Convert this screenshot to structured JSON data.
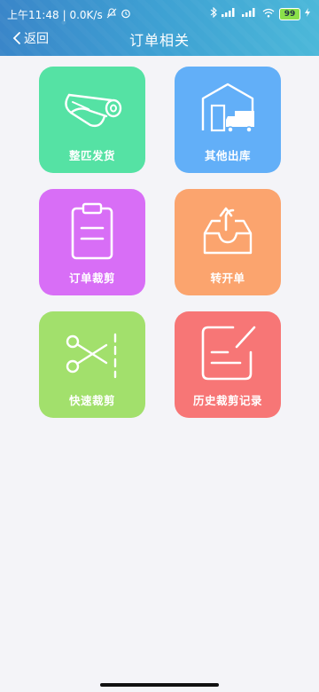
{
  "status_bar": {
    "time": "上午11:48",
    "network_speed": "| 0.0K/s",
    "battery_level": "99"
  },
  "header": {
    "back_label": "返回",
    "title": "订单相关"
  },
  "tiles": [
    {
      "label": "整匹发货",
      "color": "#55e2a4",
      "icon": "fabric-roll-icon"
    },
    {
      "label": "其他出库",
      "color": "#62aff8",
      "icon": "warehouse-truck-icon"
    },
    {
      "label": "订单裁剪",
      "color": "#d86ef6",
      "icon": "clipboard-icon"
    },
    {
      "label": "转开单",
      "color": "#fba46e",
      "icon": "inbox-upload-icon"
    },
    {
      "label": "快速裁剪",
      "color": "#a2e06c",
      "icon": "scissors-cut-icon"
    },
    {
      "label": "历史裁剪记录",
      "color": "#f77676",
      "icon": "edit-record-icon"
    }
  ]
}
